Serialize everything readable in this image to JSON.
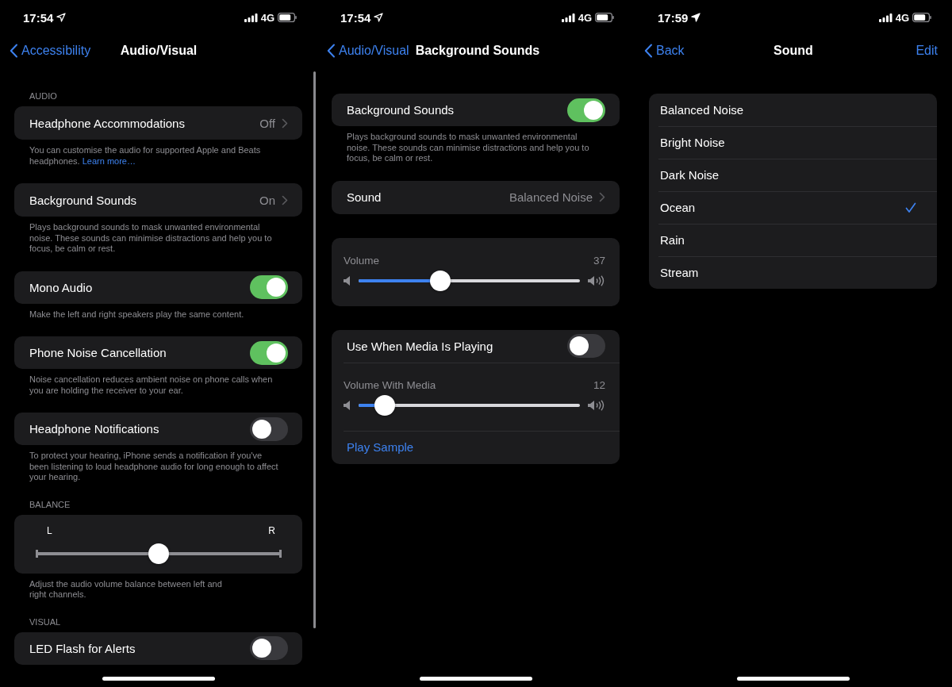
{
  "screens": [
    {
      "status": {
        "time": "17:54",
        "network": "4G"
      },
      "nav": {
        "back": "Accessibility",
        "title": "Audio/Visual"
      },
      "scrollbar": true,
      "blocks": [
        {
          "kind": "header",
          "text": "AUDIO"
        },
        {
          "kind": "group",
          "rows": [
            {
              "kind": "disclosure",
              "label": "Headphone Accommodations",
              "value": "Off"
            }
          ]
        },
        {
          "kind": "footer",
          "text": "You can customise the audio for supported Apple and Beats headphones.",
          "link": "Learn more…"
        },
        {
          "kind": "group",
          "rows": [
            {
              "kind": "disclosure",
              "label": "Background Sounds",
              "value": "On"
            }
          ]
        },
        {
          "kind": "footer",
          "text": "Plays background sounds to mask unwanted environmental noise. These sounds can minimise distractions and help you to focus, be calm or rest."
        },
        {
          "kind": "group",
          "rows": [
            {
              "kind": "toggle",
              "label": "Mono Audio",
              "on": true
            }
          ]
        },
        {
          "kind": "footer",
          "text": "Make the left and right speakers play the same content."
        },
        {
          "kind": "group",
          "rows": [
            {
              "kind": "toggle",
              "label": "Phone Noise Cancellation",
              "on": true
            }
          ]
        },
        {
          "kind": "footer",
          "text": "Noise cancellation reduces ambient noise on phone calls when you are holding the receiver to your ear."
        },
        {
          "kind": "group",
          "rows": [
            {
              "kind": "toggle",
              "label": "Headphone Notifications",
              "on": false
            }
          ]
        },
        {
          "kind": "footer",
          "text": "To protect your hearing, iPhone sends a notification if you've been listening to loud headphone audio for long enough to affect your hearing."
        },
        {
          "kind": "header",
          "text": "BALANCE"
        },
        {
          "kind": "group",
          "rows": [
            {
              "kind": "balance",
              "left": "L",
              "right": "R",
              "level": 0.5
            }
          ]
        },
        {
          "kind": "footer",
          "text": "Adjust the audio volume balance between left and right channels.",
          "narrow": true
        },
        {
          "kind": "header",
          "text": "VISUAL"
        },
        {
          "kind": "group",
          "rows": [
            {
              "kind": "toggle",
              "label": "LED Flash for Alerts",
              "on": false
            }
          ]
        }
      ]
    },
    {
      "status": {
        "time": "17:54",
        "network": "4G"
      },
      "nav": {
        "back": "Audio/Visual",
        "title": "Background Sounds"
      },
      "blocks": [
        {
          "kind": "group",
          "rows": [
            {
              "kind": "toggle",
              "label": "Background Sounds",
              "on": true
            }
          ]
        },
        {
          "kind": "footer",
          "text": "Plays background sounds to mask unwanted environmental noise. These sounds can minimise distractions and help you to focus, be calm or rest."
        },
        {
          "kind": "group",
          "rows": [
            {
              "kind": "disclosure",
              "label": "Sound",
              "value": "Balanced Noise"
            }
          ]
        },
        {
          "kind": "group",
          "rows": [
            {
              "kind": "volume",
              "label": "Volume",
              "reading": "37",
              "level": 0.37
            }
          ]
        },
        {
          "kind": "group",
          "rows": [
            {
              "kind": "toggle",
              "label": "Use When Media Is Playing",
              "on": false
            },
            {
              "kind": "volume",
              "label": "Volume With Media",
              "reading": "12",
              "level": 0.12
            },
            {
              "kind": "link",
              "label": "Play Sample"
            }
          ]
        }
      ]
    },
    {
      "status": {
        "time": "17:59",
        "network": "4G"
      },
      "nav": {
        "back": "Back",
        "title": "Sound",
        "action": "Edit"
      },
      "blocks": [
        {
          "kind": "group",
          "rows": [
            {
              "kind": "option",
              "label": "Balanced Noise",
              "selected": false
            },
            {
              "kind": "option",
              "label": "Bright Noise",
              "selected": false
            },
            {
              "kind": "option",
              "label": "Dark Noise",
              "selected": false
            },
            {
              "kind": "option",
              "label": "Ocean",
              "selected": true
            },
            {
              "kind": "option",
              "label": "Rain",
              "selected": false
            },
            {
              "kind": "option",
              "label": "Stream",
              "selected": false
            }
          ]
        }
      ]
    }
  ]
}
